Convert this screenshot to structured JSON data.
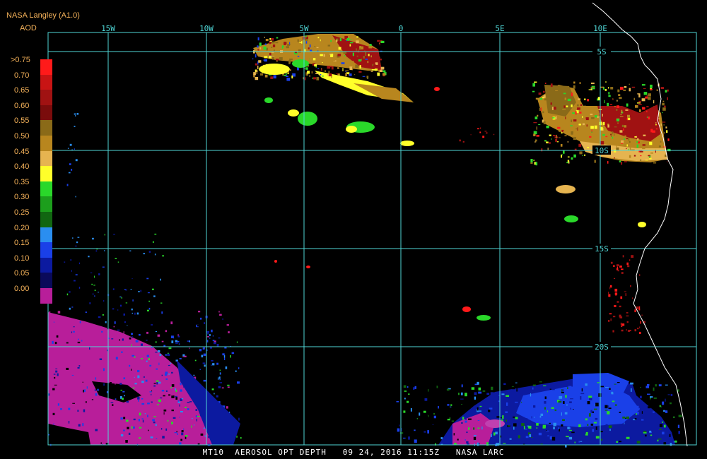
{
  "header": {
    "org_label": "NASA Langley (A1.0)",
    "product_label": "AOD"
  },
  "colorbar": {
    "labels": [
      ">0.75",
      "0.70",
      "0.65",
      "0.60",
      "0.55",
      "0.50",
      "0.45",
      "0.40",
      "0.35",
      "0.30",
      "0.25",
      "0.20",
      "0.15",
      "0.10",
      "0.05",
      "0.00"
    ],
    "colors": [
      "#ff1a1a",
      "#c81414",
      "#a01212",
      "#7a0c0c",
      "#8a6a18",
      "#b8861e",
      "#e6b450",
      "#ffff2a",
      "#2ad82a",
      "#1c9e1c",
      "#116611",
      "#2a8ef0",
      "#1a40e8",
      "#0c1aa0",
      "#0a0a5a",
      "#b81e9a"
    ]
  },
  "map": {
    "lon_labels": [
      "15W",
      "10W",
      "5W",
      "0",
      "5E",
      "10E"
    ],
    "lat_labels": [
      "5S",
      "10S",
      "15S",
      "20S"
    ],
    "grid_color": "#4fd6d6",
    "coast_color": "#ffffff",
    "background": "#000000"
  },
  "footer": {
    "text": "MT10  AEROSOL OPT DEPTH   09 24, 2016 11:15Z   NASA LARC"
  }
}
